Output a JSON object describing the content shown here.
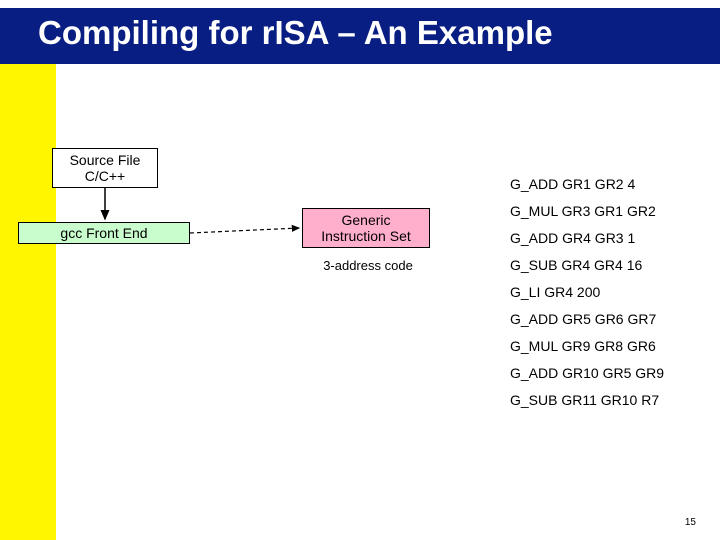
{
  "title": "Compiling for rISA – An Example",
  "boxes": {
    "source_l1": "Source File",
    "source_l2": "C/C++",
    "gcc": "gcc Front End",
    "instr_l1": "Generic",
    "instr_l2": "Instruction Set",
    "caption_3addr": "3-address code"
  },
  "instructions": [
    "G_ADD GR1 GR2 4",
    "G_MUL GR3 GR1 GR2",
    "G_ADD GR4 GR3 1",
    "G_SUB GR4 GR4 16",
    "G_LI GR4 200",
    "G_ADD GR5 GR6 GR7",
    "G_MUL GR9 GR8 GR6",
    "G_ADD GR10 GR5 GR9",
    "G_SUB GR11 GR10 R7"
  ],
  "page_number": "15"
}
